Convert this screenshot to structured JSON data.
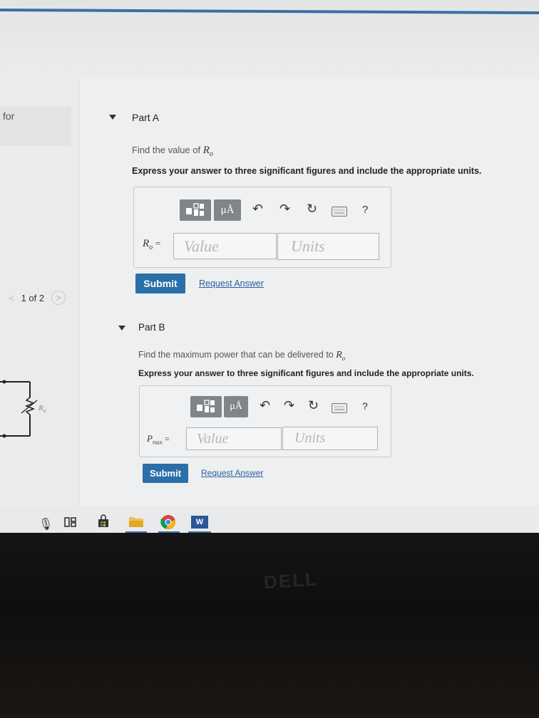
{
  "sidebar": {
    "partial_text": "for"
  },
  "pager": {
    "prev": "<",
    "text": "1 of 2",
    "next": ">"
  },
  "parts": [
    {
      "title": "Part A",
      "question_prefix": "Find the value of",
      "question_var": "R",
      "question_sub": "o",
      "instruction": "Express your answer to three significant figures and include the appropriate units.",
      "label_var": "R",
      "label_sub": "o",
      "label_eq": "=",
      "value_placeholder": "Value",
      "units_placeholder": "Units",
      "submit": "Submit",
      "request": "Request Answer"
    },
    {
      "title": "Part B",
      "question_prefix": "Find the maximum power that can be delivered to",
      "question_var": "R",
      "question_sub": "o",
      "instruction": "Express your answer to three significant figures and include the appropriate units.",
      "label_var": "P",
      "label_sub": "max",
      "label_eq": "=",
      "value_placeholder": "Value",
      "units_placeholder": "Units",
      "submit": "Submit",
      "request": "Request Answer"
    }
  ],
  "toolbar": {
    "units_symbol": "μÅ",
    "help": "?"
  },
  "circuit": {
    "resistor_label": "R",
    "resistor_sub": "o"
  },
  "taskbar": {
    "word_label": "W"
  },
  "monitor_brand": "DELL"
}
